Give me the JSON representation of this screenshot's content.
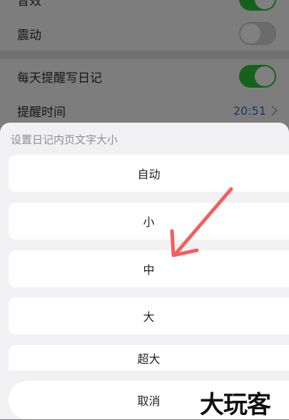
{
  "settings": {
    "rows": [
      {
        "label": "音效",
        "toggle": "on"
      },
      {
        "label": "震动",
        "toggle": "off"
      },
      {
        "label": "每天提醒写日记",
        "toggle": "on"
      },
      {
        "label": "提醒时间",
        "value": "20:51"
      }
    ]
  },
  "sheet": {
    "title": "设置日记内页文字大小",
    "options": [
      "自动",
      "小",
      "中",
      "大",
      "超大"
    ],
    "cancel": "取消"
  },
  "annotation": {
    "color": "#f25f5c",
    "points_to": "中"
  },
  "watermark": {
    "text": "大玩客"
  },
  "colors": {
    "toggle_on": "#34c759",
    "time": "#3a7bd5"
  }
}
